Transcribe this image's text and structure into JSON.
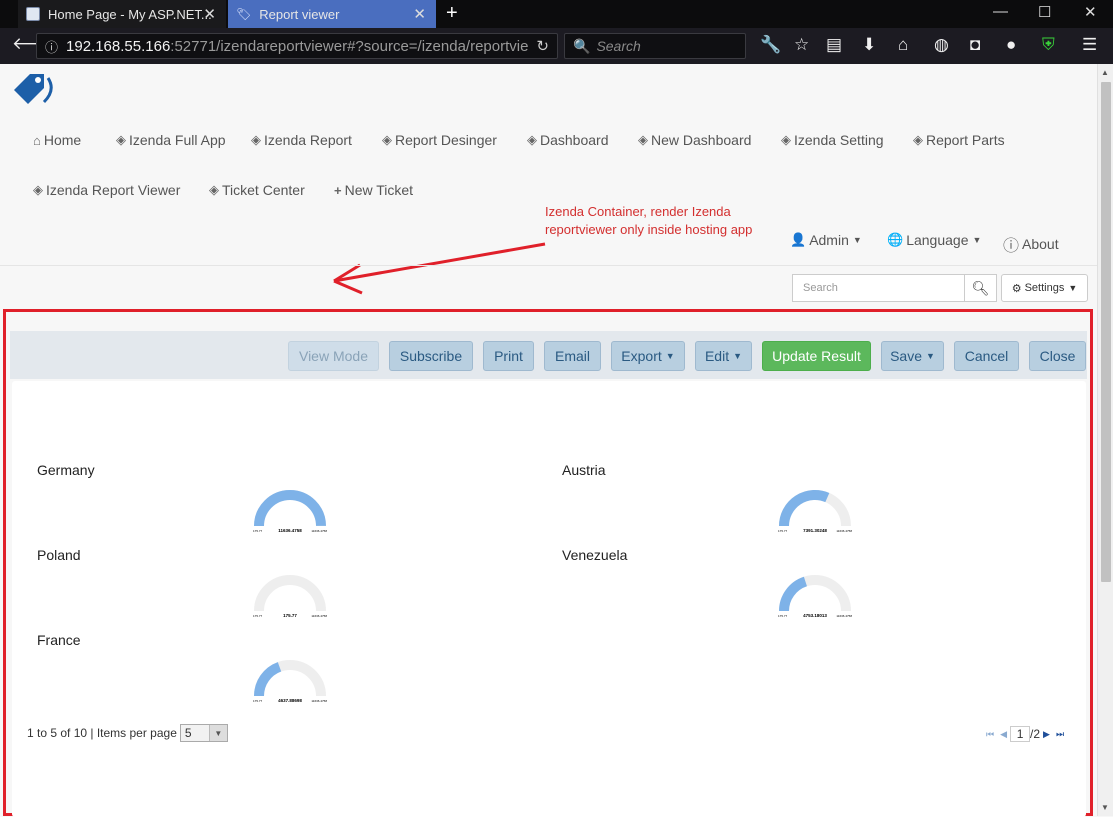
{
  "browser": {
    "tabs": [
      {
        "title": "Home Page - My ASP.NET..."
      },
      {
        "title": "Report viewer"
      }
    ],
    "url_host": "192.168.55.166",
    "url_path": ":52771/izendareportviewer#?source=/izenda/reportvie",
    "search_placeholder": "Search"
  },
  "nav": {
    "row1": [
      "Home",
      "Izenda Full App",
      "Izenda Report",
      "Report Desinger",
      "Dashboard",
      "New Dashboard",
      "Izenda Setting",
      "Report Parts"
    ],
    "row2": [
      "Izenda Report Viewer",
      "Ticket Center",
      "New Ticket"
    ],
    "admin": "Admin",
    "language": "Language",
    "about": "About"
  },
  "annotation": "Izenda Container, render Izenda reportviewer only inside hosting app",
  "page_search": {
    "placeholder": "Search"
  },
  "settings_label": "Settings",
  "toolbar": {
    "view_mode": "View Mode",
    "subscribe": "Subscribe",
    "print": "Print",
    "email": "Email",
    "export": "Export",
    "edit": "Edit",
    "update_result": "Update Result",
    "save": "Save",
    "cancel": "Cancel",
    "close": "Close"
  },
  "gauges": [
    {
      "country": "Germany",
      "value_label": "11636.4758",
      "min_label": "175.77",
      "max_label": "11636.4758",
      "fraction": 1.0
    },
    {
      "country": "Austria",
      "value_label": "7391.30248",
      "min_label": "175.77",
      "max_label": "11636.4758",
      "fraction": 0.63
    },
    {
      "country": "Poland",
      "value_label": "175.77",
      "min_label": "175.77",
      "max_label": "11636.4758",
      "fraction": 0.0
    },
    {
      "country": "Venezuela",
      "value_label": "4753.18013",
      "min_label": "175.77",
      "max_label": "11636.4758",
      "fraction": 0.4
    },
    {
      "country": "France",
      "value_label": "4637.88698",
      "min_label": "175.77",
      "max_label": "11636.4758",
      "fraction": 0.39
    }
  ],
  "pager": {
    "summary": "1 to 5 of 10 | Items per page",
    "per_page": "5",
    "current_page": "1",
    "total_pages": "/2"
  },
  "colors": {
    "gauge_fill": "#7eb2e8",
    "gauge_track": "#eeeeee",
    "annotation": "#d32f2f",
    "container_border": "#e0202a"
  }
}
